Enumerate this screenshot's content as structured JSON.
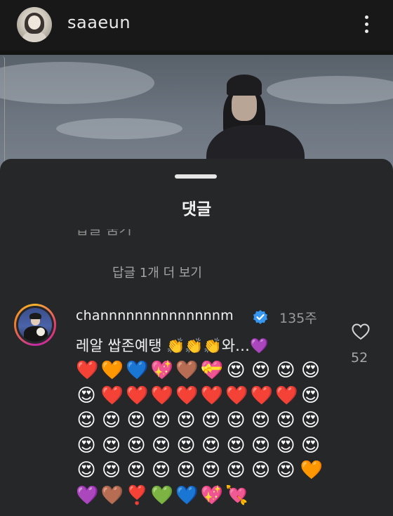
{
  "header": {
    "username": "saaeun",
    "avatar_icon": "profile-avatar",
    "menu_icon": "more-vertical-icon"
  },
  "post": {
    "image": "photo-woman-in-black-cap"
  },
  "comments_sheet": {
    "title": "댓글",
    "partial_reply_text": "답글 숨기",
    "view_more_replies": "답글 1개 더 보기",
    "comment": {
      "username": "channnnnnnnnnnnnnm",
      "verified": true,
      "time": "135주",
      "text": "레알 쌉존예탱 👏👏👏와…💜",
      "like_count": "52",
      "emoji_rows": [
        [
          "❤️",
          "🧡",
          "💙",
          "💖",
          "🤎",
          "💝",
          "😍",
          "😍",
          "😍",
          "😍"
        ],
        [
          "😍",
          "❤️",
          "❤️",
          "❤️",
          "❤️",
          "❤️",
          "❤️",
          "❤️",
          "❤️",
          "😍"
        ],
        [
          "😍",
          "😍",
          "😍",
          "😍",
          "😍",
          "😍",
          "😍",
          "😍",
          "😍",
          "😍"
        ],
        [
          "😍",
          "😍",
          "😍",
          "😍",
          "😍",
          "😍",
          "😍",
          "😍",
          "😍",
          "😍"
        ],
        [
          "😍",
          "😍",
          "😍",
          "😍",
          "😍",
          "😍",
          "😍",
          "😍",
          "😍",
          "🧡"
        ],
        [
          "💜",
          "🤎",
          "❣️",
          "💚",
          "💙",
          "💖",
          "💘"
        ]
      ]
    }
  },
  "colors": {
    "background": "#141414",
    "sheet": "#262729",
    "verified_blue": "#3797f0",
    "secondary_text": "#9a9a9a"
  }
}
